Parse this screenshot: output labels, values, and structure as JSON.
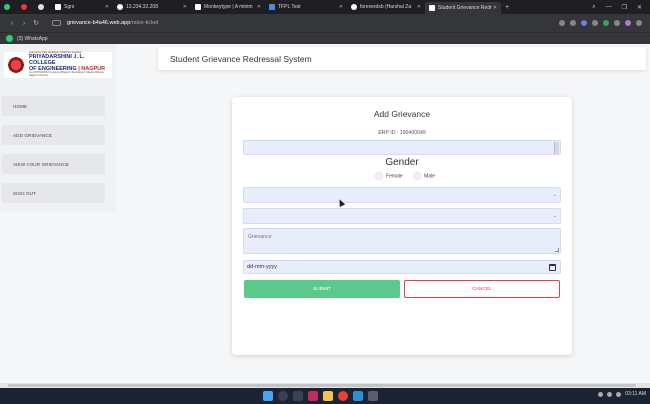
{
  "browser": {
    "tabs": [
      {
        "label": "",
        "color": "#25d366"
      },
      {
        "label": "",
        "color": "#e53935"
      },
      {
        "label": "",
        "color": "#e0e0e0"
      },
      {
        "label": "Sgrs",
        "color": "#ffffff"
      },
      {
        "label": "13.234.32.208",
        "color": "#ffffff"
      },
      {
        "label": "Monkeytype | A minim",
        "color": "#ffffff"
      },
      {
        "label": "TFPL Test",
        "color": "#4a90e2"
      },
      {
        "label": "foreverdsb (Harshal Za",
        "color": "#ffffff"
      },
      {
        "label": "Student Grievance Redr",
        "color": "#ffffff"
      }
    ],
    "url_host": "grievance-b4a46.web.app",
    "url_path": "/raise-ticket",
    "bookmark": "(3) WhatsApp"
  },
  "logo": {
    "line1": "Lokmanya Tilak Jankalyan Shikshan Sanstha",
    "line2": "PRIYADARSHINI J. L. COLLEGE",
    "line3a": "OF ENGINEERING",
    "line3b": "| NAGPUR",
    "line4": "An AUTONOMOUS Institute Affiliated to Rashtrasant Tukadoji Maharaj Nagpur University"
  },
  "sidebar": {
    "items": [
      {
        "label": "HOME"
      },
      {
        "label": "ADD GRIEVANCE"
      },
      {
        "label": "VIEW YOUR GRIEVANCE"
      },
      {
        "label": "SIGN OUT"
      }
    ]
  },
  "header": {
    "title": "Student Grievance Redressal System"
  },
  "form": {
    "title": "Add Grievance",
    "erp": "ERP ID : 190400049",
    "gender_label": "Gender",
    "female": "Female",
    "male": "Male",
    "grievance_placeholder": "Grievance",
    "date_placeholder": "dd-mm-yyyy",
    "submit": "SUBMIT",
    "cancel": "CANCEL"
  },
  "taskbar": {
    "time": "03:11 AM"
  }
}
